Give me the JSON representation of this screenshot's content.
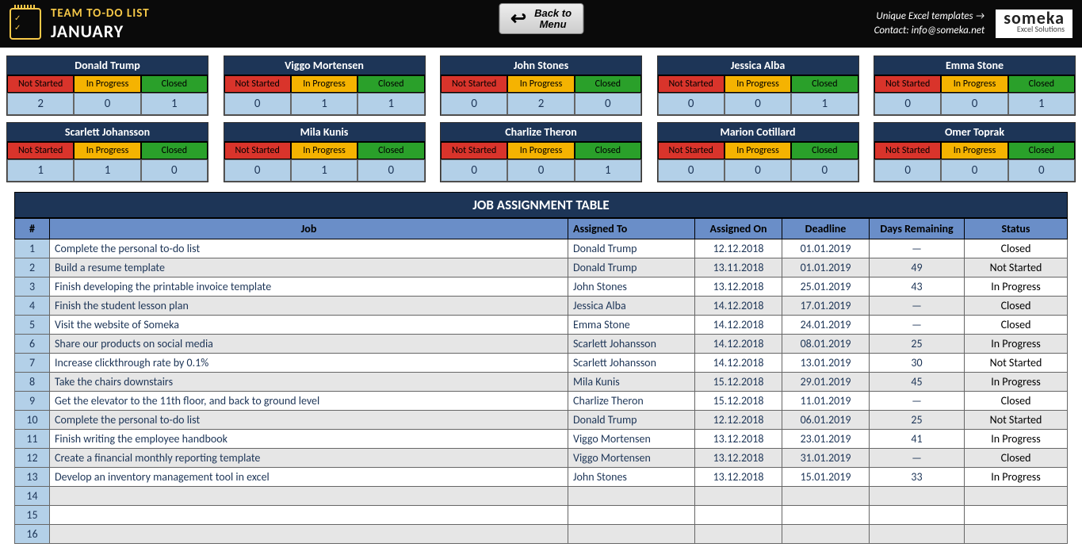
{
  "header": {
    "title": "TEAM TO-DO LIST",
    "month": "JANUARY",
    "back_label": "Back to\nMenu",
    "link_templates": "Unique Excel templates →",
    "link_contact": "Contact: info@someka.net",
    "brand": "someka",
    "brand_sub": "Excel Solutions"
  },
  "status_labels": {
    "ns": "Not Started",
    "ip": "In Progress",
    "cl": "Closed"
  },
  "teams": [
    {
      "name": "Donald Trump",
      "ns": 2,
      "ip": 0,
      "cl": 1
    },
    {
      "name": "Viggo Mortensen",
      "ns": 0,
      "ip": 1,
      "cl": 1
    },
    {
      "name": "John Stones",
      "ns": 0,
      "ip": 2,
      "cl": 0
    },
    {
      "name": "Jessica Alba",
      "ns": 0,
      "ip": 0,
      "cl": 1
    },
    {
      "name": "Emma Stone",
      "ns": 0,
      "ip": 0,
      "cl": 1
    },
    {
      "name": "Scarlett Johansson",
      "ns": 1,
      "ip": 1,
      "cl": 0
    },
    {
      "name": "Mila Kunis",
      "ns": 0,
      "ip": 1,
      "cl": 0
    },
    {
      "name": "Charlize Theron",
      "ns": 0,
      "ip": 0,
      "cl": 1
    },
    {
      "name": "Marion Cotillard",
      "ns": 0,
      "ip": 0,
      "cl": 0
    },
    {
      "name": "Omer Toprak",
      "ns": 0,
      "ip": 0,
      "cl": 0
    }
  ],
  "job_table": {
    "title": "JOB ASSIGNMENT TABLE",
    "headers": {
      "num": "#",
      "job": "Job",
      "assigned_to": "Assigned To",
      "assigned_on": "Assigned On",
      "deadline": "Deadline",
      "days": "Days Remaining",
      "status": "Status"
    },
    "rows": [
      {
        "n": "1",
        "job": "Complete the personal to-do list",
        "to": "Donald Trump",
        "on": "12.12.2018",
        "dl": "01.01.2019",
        "days": "—",
        "status": "Closed"
      },
      {
        "n": "2",
        "job": "Build a resume template",
        "to": "Donald Trump",
        "on": "13.11.2018",
        "dl": "01.01.2019",
        "days": "49",
        "status": "Not Started"
      },
      {
        "n": "3",
        "job": "Finish developing the printable invoice template",
        "to": "John Stones",
        "on": "13.12.2018",
        "dl": "25.01.2019",
        "days": "43",
        "status": "In Progress"
      },
      {
        "n": "4",
        "job": "Finish the student lesson plan",
        "to": "Jessica Alba",
        "on": "14.12.2018",
        "dl": "17.01.2019",
        "days": "—",
        "status": "Closed"
      },
      {
        "n": "5",
        "job": "Visit the website of Someka",
        "to": "Emma Stone",
        "on": "14.12.2018",
        "dl": "24.01.2019",
        "days": "—",
        "status": "Closed"
      },
      {
        "n": "6",
        "job": "Share our products on social media",
        "to": "Scarlett Johansson",
        "on": "14.12.2018",
        "dl": "08.01.2019",
        "days": "25",
        "status": "In Progress"
      },
      {
        "n": "7",
        "job": "Increase clickthrough rate by 0.1%",
        "to": "Scarlett Johansson",
        "on": "14.12.2018",
        "dl": "13.01.2019",
        "days": "30",
        "status": "Not Started"
      },
      {
        "n": "8",
        "job": "Take the chairs downstairs",
        "to": "Mila Kunis",
        "on": "15.12.2018",
        "dl": "29.01.2019",
        "days": "45",
        "status": "In Progress"
      },
      {
        "n": "9",
        "job": "Get the elevator to the 11th floor, and back to ground level",
        "to": "Charlize Theron",
        "on": "15.12.2018",
        "dl": "11.01.2019",
        "days": "—",
        "status": "Closed"
      },
      {
        "n": "10",
        "job": "Complete the personal to-do list",
        "to": "Donald Trump",
        "on": "12.12.2018",
        "dl": "06.01.2019",
        "days": "25",
        "status": "Not Started"
      },
      {
        "n": "11",
        "job": "Finish writing the employee handbook",
        "to": "Viggo Mortensen",
        "on": "13.12.2018",
        "dl": "23.01.2019",
        "days": "41",
        "status": "In Progress"
      },
      {
        "n": "12",
        "job": "Create a financial monthly reporting template",
        "to": "Viggo Mortensen",
        "on": "13.12.2018",
        "dl": "31.01.2019",
        "days": "—",
        "status": "Closed"
      },
      {
        "n": "13",
        "job": "Develop an inventory management tool in excel",
        "to": "John Stones",
        "on": "13.12.2018",
        "dl": "15.01.2019",
        "days": "33",
        "status": "In Progress"
      },
      {
        "n": "14",
        "job": "",
        "to": "",
        "on": "",
        "dl": "",
        "days": "",
        "status": ""
      },
      {
        "n": "15",
        "job": "",
        "to": "",
        "on": "",
        "dl": "",
        "days": "",
        "status": ""
      },
      {
        "n": "16",
        "job": "",
        "to": "",
        "on": "",
        "dl": "",
        "days": "",
        "status": ""
      }
    ]
  }
}
